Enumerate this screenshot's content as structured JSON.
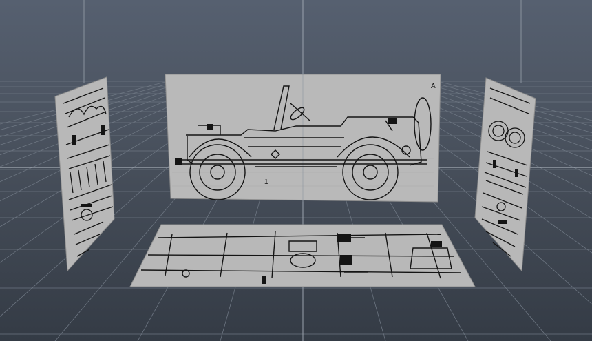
{
  "viewport": {
    "background_top": "#566070",
    "background_bottom": "#333a44",
    "grid_color": "#6b7480",
    "axis_color": "#9aa2ad",
    "plane_color": "#b7b7b7",
    "ink_color": "#141414"
  },
  "reference_images": [
    {
      "name": "front-view-blueprint",
      "label": ""
    },
    {
      "name": "side-view-blueprint",
      "label": "A",
      "secondary_label": "1"
    },
    {
      "name": "rear-view-blueprint",
      "label": ""
    },
    {
      "name": "top-view-blueprint",
      "label": ""
    }
  ]
}
